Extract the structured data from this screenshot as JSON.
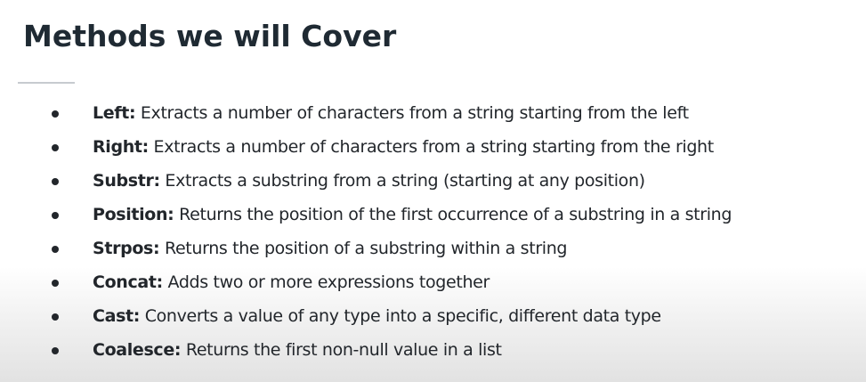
{
  "slide": {
    "title": "Methods we will Cover",
    "items": [
      {
        "term": "Left:",
        "description": " Extracts a number of characters from a string starting from the left"
      },
      {
        "term": "Right:",
        "description": " Extracts a number of characters from a string starting from the right"
      },
      {
        "term": "Substr:",
        "description": " Extracts a substring from a string (starting at any position)"
      },
      {
        "term": "Position:",
        "description": " Returns the position of the first occurrence of a substring in a string"
      },
      {
        "term": "Strpos:",
        "description": " Returns the position of a substring within a string"
      },
      {
        "term": "Concat:",
        "description": " Adds two or more expressions together"
      },
      {
        "term": "Cast:",
        "description": " Converts a value of any type into a specific, different data type"
      },
      {
        "term": "Coalesce:",
        "description": " Returns the first non-null value in a list"
      }
    ]
  }
}
